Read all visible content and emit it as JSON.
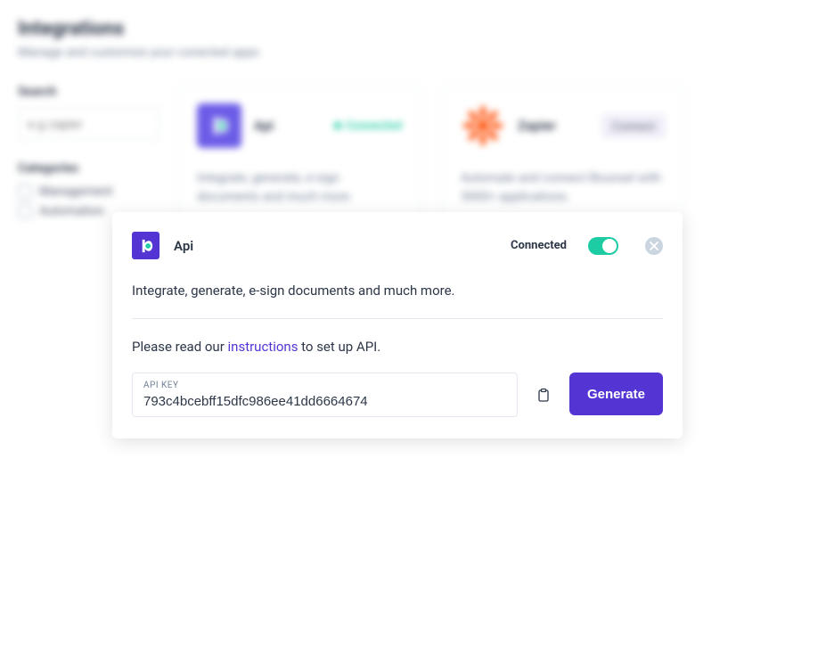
{
  "header": {
    "title": "Integrations",
    "subtitle": "Manage and customize your conected apps"
  },
  "sidebar": {
    "search_label": "Search",
    "search_placeholder": "e.g zapier",
    "categories_label": "Categories",
    "categories": [
      {
        "label": "Management"
      },
      {
        "label": "Automation"
      }
    ]
  },
  "cards": [
    {
      "name": "Api",
      "status": "Connected",
      "connected": true,
      "desc": "Integrate, generate, e-sign documents and much more."
    },
    {
      "name": "Zapier",
      "status": "Connect",
      "connected": false,
      "desc": "Automate and connect Bounsel with 3000+ applications."
    }
  ],
  "modal": {
    "title": "Api",
    "connected_label": "Connected",
    "desc": "Integrate, generate, e-sign documents and much more.",
    "instructions_prefix": "Please read our ",
    "instructions_link": "instructions",
    "instructions_suffix": " to set up API.",
    "api_key_label": "API KEY",
    "api_key_value": "793c4bcebff15dfc986ee41dd6664674",
    "generate_label": "Generate"
  },
  "colors": {
    "primary": "#5435d4",
    "teal": "#1ecca4",
    "zapier": "#ff4a00"
  }
}
